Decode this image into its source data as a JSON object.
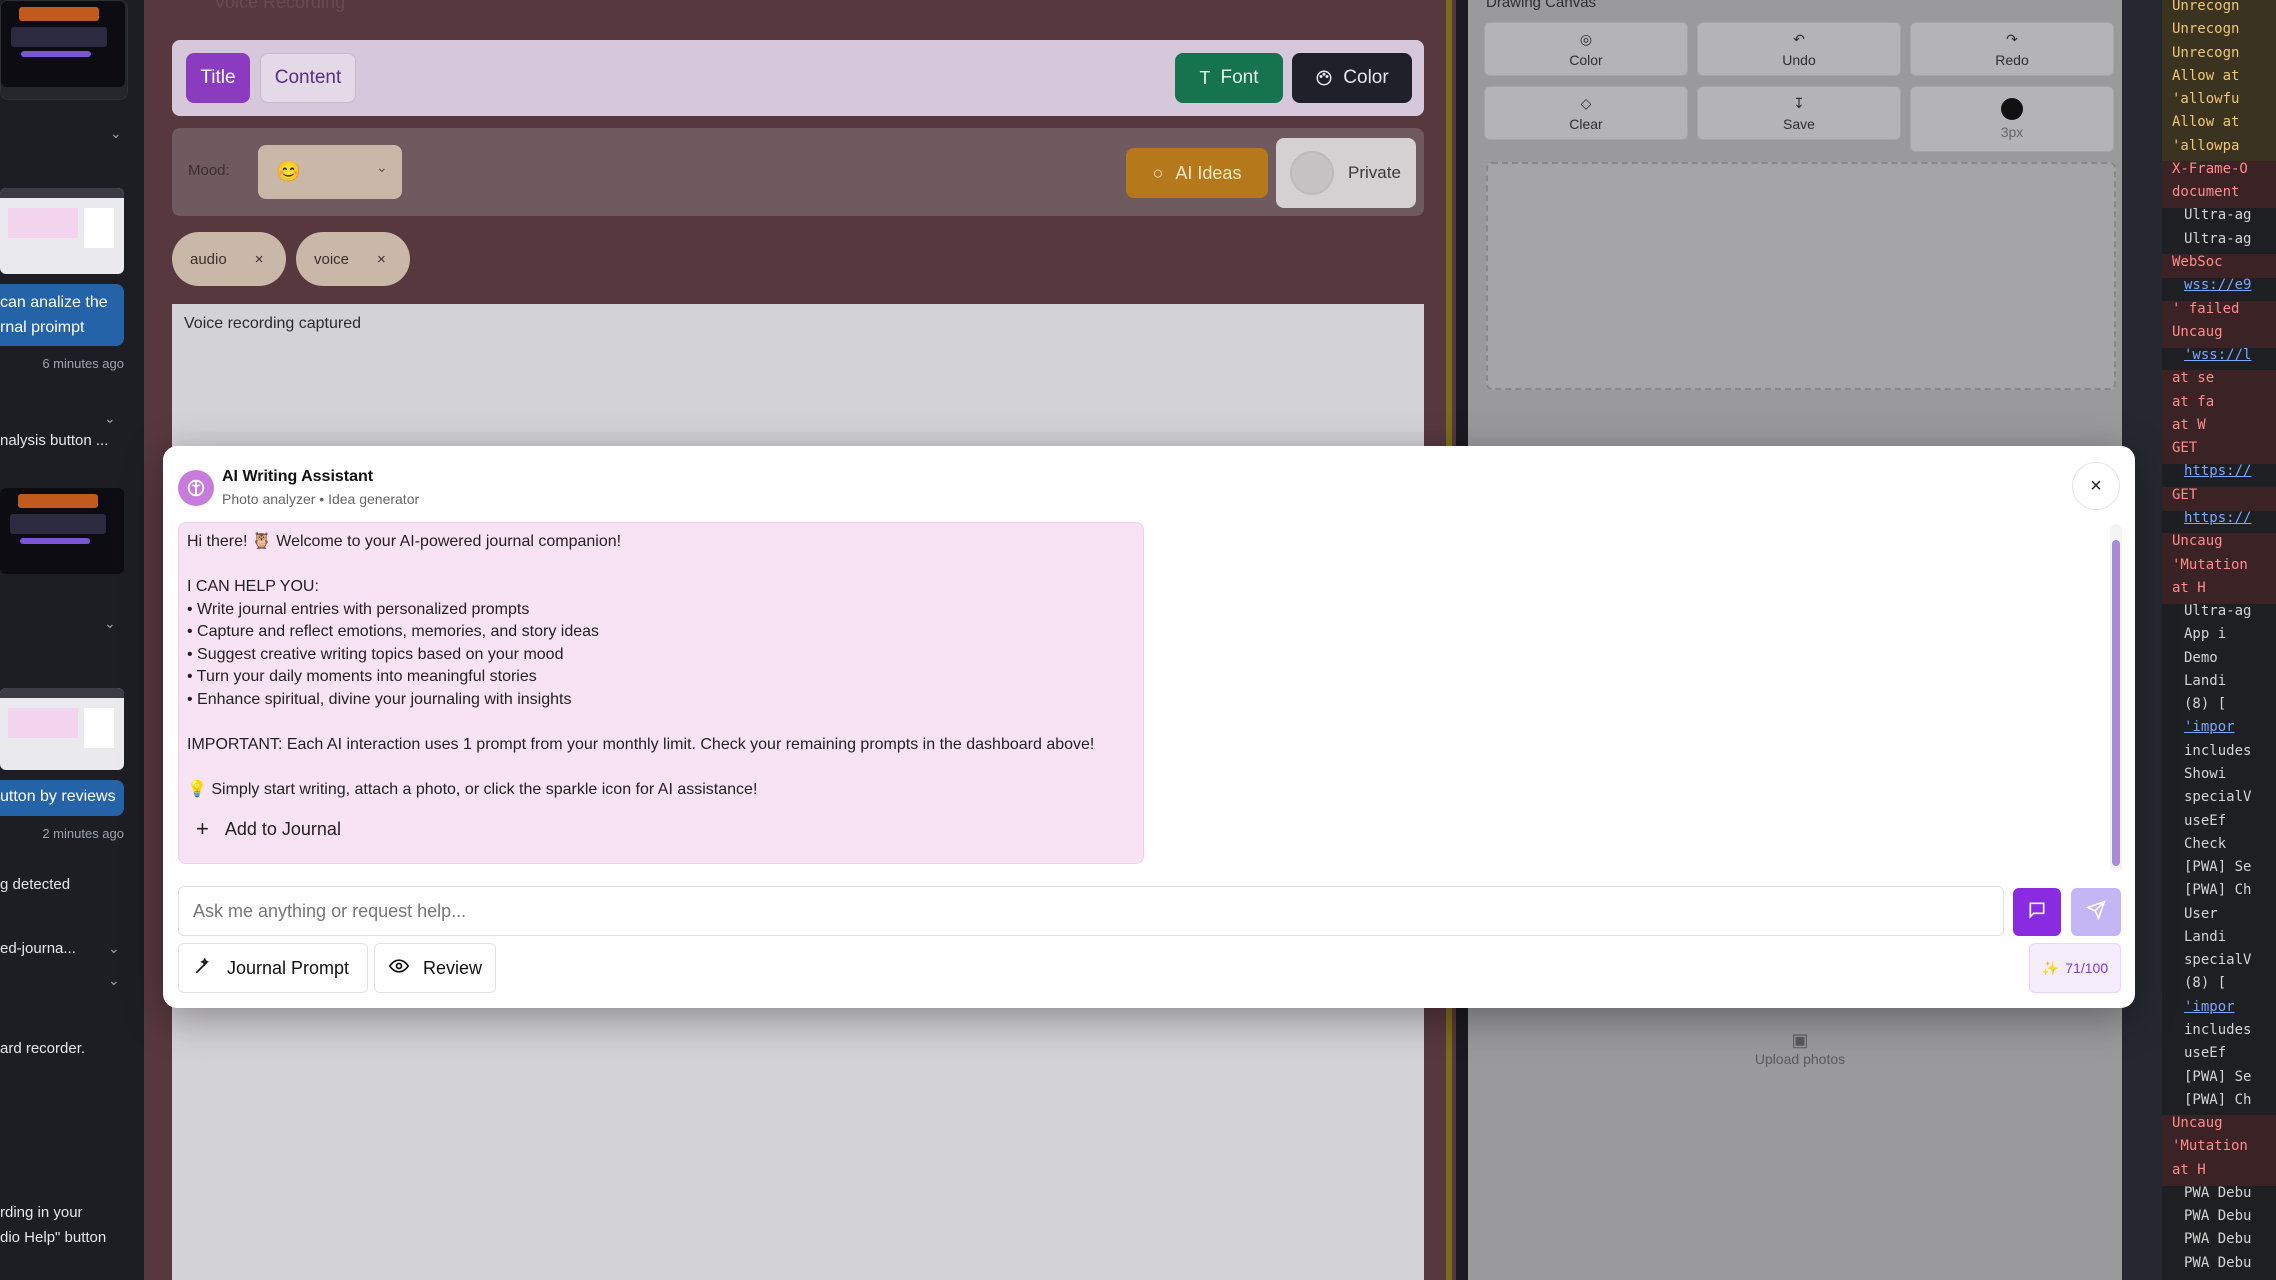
{
  "left_panel": {
    "msg1": "can analize the\nrnal proimpt",
    "msg1_time": "6 minutes ago",
    "item1": "nalysis button ...",
    "msg2": "utton by reviews",
    "msg2_time": "2 minutes ago",
    "item2": "g detected",
    "item3": "ed-journa...",
    "item4": "ard recorder.",
    "item5_line1": "rding in your",
    "item5_line2": "dio Help\" button"
  },
  "editor": {
    "section_title": "Voice Recording",
    "title_tab": "Title",
    "content_tab": "Content",
    "font_btn": "Font",
    "color_btn": "Color",
    "mood_label": "Mood:",
    "mood_value": "😊",
    "ai_ideas": "AI Ideas",
    "private": "Private",
    "tags": [
      "audio",
      "voice"
    ],
    "content_text": "Voice recording captured"
  },
  "drawing": {
    "title": "Drawing Canvas",
    "tools": [
      "Color",
      "Undo",
      "Redo",
      "Clear",
      "Save",
      "3px"
    ],
    "upload": "Upload photos"
  },
  "console": {
    "lines": [
      {
        "t": "Unrecogn",
        "k": "w"
      },
      {
        "t": "Unrecogn",
        "k": "w"
      },
      {
        "t": "Unrecogn",
        "k": "w"
      },
      {
        "t": "Allow at",
        "k": "w"
      },
      {
        "t": "'allowfu",
        "k": "w"
      },
      {
        "t": "Allow at",
        "k": "w"
      },
      {
        "t": "'allowpa",
        "k": "w"
      },
      {
        "t": "X-Frame-O",
        "k": "e"
      },
      {
        "t": "document",
        "k": "e"
      },
      {
        "t": "Ultra-ag",
        "k": "n"
      },
      {
        "t": "Ultra-ag",
        "k": "n"
      },
      {
        "t": "WebSoc",
        "k": "e"
      },
      {
        "t": "wss://e9",
        "k": "l"
      },
      {
        "t": "' failed",
        "k": "e"
      },
      {
        "t": "Uncaug",
        "k": "e"
      },
      {
        "t": "'wss://l",
        "k": "l"
      },
      {
        "t": "at se",
        "k": "e"
      },
      {
        "t": "at fa",
        "k": "e"
      },
      {
        "t": "at W",
        "k": "e"
      },
      {
        "t": "GET",
        "k": "e"
      },
      {
        "t": "https://",
        "k": "l"
      },
      {
        "t": "GET",
        "k": "e"
      },
      {
        "t": "https://",
        "k": "l"
      },
      {
        "t": "Uncaug",
        "k": "e"
      },
      {
        "t": "'Mutation",
        "k": "e"
      },
      {
        "t": "at H",
        "k": "e"
      },
      {
        "t": "Ultra-ag",
        "k": "n"
      },
      {
        "t": "App i",
        "k": "n"
      },
      {
        "t": "Demo",
        "k": "n"
      },
      {
        "t": "Landi",
        "k": "n"
      },
      {
        "t": "(8) [",
        "k": "n"
      },
      {
        "t": "'impor",
        "k": "l"
      },
      {
        "t": "includes",
        "k": "n"
      },
      {
        "t": "Showi",
        "k": "n"
      },
      {
        "t": "specialV",
        "k": "n"
      },
      {
        "t": "useEf",
        "k": "n"
      },
      {
        "t": "Check",
        "k": "n"
      },
      {
        "t": "[PWA] Se",
        "k": "n"
      },
      {
        "t": "[PWA] Ch",
        "k": "n"
      },
      {
        "t": "User",
        "k": "n"
      },
      {
        "t": "Landi",
        "k": "n"
      },
      {
        "t": "specialV",
        "k": "n"
      },
      {
        "t": "(8) [",
        "k": "n"
      },
      {
        "t": "'impor",
        "k": "l"
      },
      {
        "t": "includes",
        "k": "n"
      },
      {
        "t": "useEf",
        "k": "n"
      },
      {
        "t": "[PWA] Se",
        "k": "n"
      },
      {
        "t": "[PWA] Ch",
        "k": "n"
      },
      {
        "t": "Uncaug",
        "k": "e"
      },
      {
        "t": "'Mutation",
        "k": "e"
      },
      {
        "t": "at H",
        "k": "e"
      },
      {
        "t": "PWA Debu",
        "k": "n"
      },
      {
        "t": "PWA Debu",
        "k": "n"
      },
      {
        "t": "PWA Debu",
        "k": "n"
      },
      {
        "t": "PWA Debu",
        "k": "n"
      }
    ]
  },
  "modal": {
    "title": "AI Writing Assistant",
    "subtitle": "Photo analyzer • Idea generator",
    "message": "Hi there! 🦉 Welcome to your AI-powered journal companion!\n\nI CAN HELP YOU:\n• Write journal entries with personalized prompts\n• Capture and reflect emotions, memories, and story ideas\n• Suggest creative writing topics based on your mood\n• Turn your daily moments into meaningful stories\n• Enhance spiritual, divine your journaling with insights\n\nIMPORTANT: Each AI interaction uses 1 prompt from your monthly limit. Check your remaining prompts in the dashboard above!\n\n💡 Simply start writing, attach a photo, or click the sparkle icon for AI assistance!",
    "add_to_journal": "Add to Journal",
    "input_placeholder": "Ask me anything or request help...",
    "journal_prompt": "Journal Prompt",
    "review": "Review",
    "counter": "71/100"
  },
  "colors": {
    "accent_purple": "#8a2be2",
    "send_lavender": "#c4b5f5",
    "bubble_pink": "#f8e3f4"
  }
}
